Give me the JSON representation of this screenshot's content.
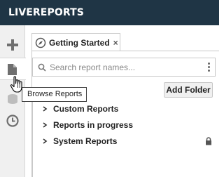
{
  "app": {
    "title": "LIVEREPORTS"
  },
  "rail": {
    "buttons": [
      {
        "name": "new-report",
        "icon": "plus-icon"
      },
      {
        "name": "browse-reports",
        "icon": "document-icon",
        "active": true
      },
      {
        "name": "data-sources",
        "icon": "database-icon"
      },
      {
        "name": "recent",
        "icon": "clock-icon"
      }
    ]
  },
  "tabs": [
    {
      "label": "Getting Started",
      "icon": "compass-icon",
      "close": "×"
    }
  ],
  "search": {
    "placeholder": "Search report names...",
    "value": ""
  },
  "toolbar": {
    "add_folder_label": "Add Folder"
  },
  "tree": {
    "items": [
      {
        "label": "Custom Reports",
        "locked": false
      },
      {
        "label": "Reports in progress",
        "locked": false
      },
      {
        "label": "System Reports",
        "locked": true
      }
    ]
  },
  "tooltip": {
    "text": "Browse Reports"
  },
  "colors": {
    "header_bg": "#1f3545",
    "rail_bg": "#f0f0f0",
    "icon_gray": "#6f6f6f"
  }
}
